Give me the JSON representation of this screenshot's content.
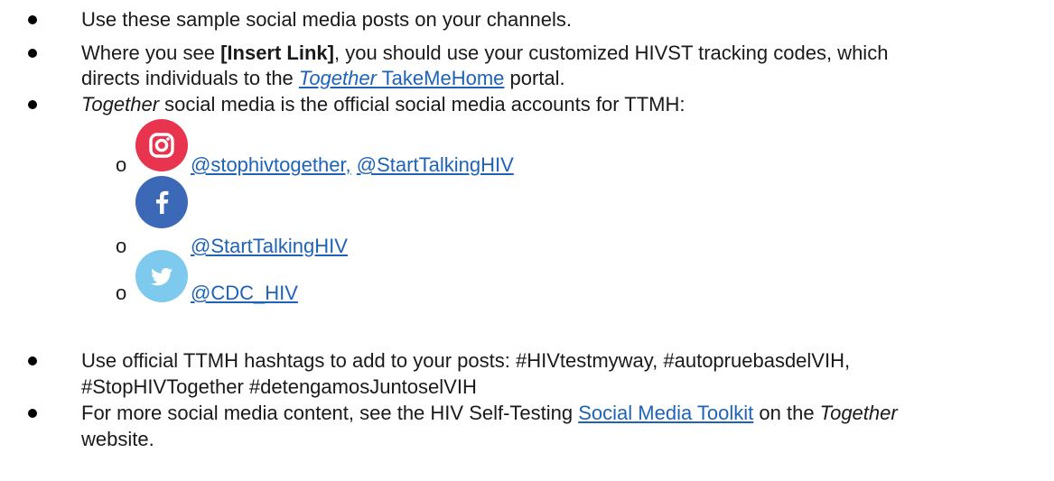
{
  "bullets": {
    "b1": "Use these sample social media posts on your channels.",
    "b2": {
      "pre": "Where you see ",
      "bold": "[Insert Link]",
      "post": ", you should use your customized HIVST tracking codes, which",
      "line2_pre": "directs individuals to the ",
      "link_italic": "Together",
      "link_rest": " TakeMeHome",
      "line2_post": " portal."
    },
    "b3": {
      "italic": "Together",
      "rest": " social media is the official social media accounts for TTMH:"
    },
    "b4": {
      "line1": "Use official TTMH hashtags to add to your posts: #HIVtestmyway, #autopruebasdelVIH,",
      "line2": "#StopHIVTogether #detengamosJuntoselVIH"
    },
    "b5": {
      "pre": "For more social media content, see the HIV Self-Testing ",
      "link": "Social Media Toolkit",
      "mid": " on the ",
      "italic": "Together",
      "line2": "website."
    }
  },
  "social": [
    {
      "icon": "instagram-icon",
      "handles": [
        "@stophivtogether,",
        "@StartTalkingHIV"
      ]
    },
    {
      "icon": "facebook-icon",
      "handles": [
        "@StartTalkingHIV"
      ]
    },
    {
      "icon": "twitter-icon",
      "handles": [
        "@CDC_HIV"
      ]
    }
  ],
  "sub_bullet_marker": "o",
  "colors": {
    "link": "#1f63b8",
    "instagram": "#e9344f",
    "facebook": "#3c68b8",
    "twitter": "#7ec9ee"
  }
}
